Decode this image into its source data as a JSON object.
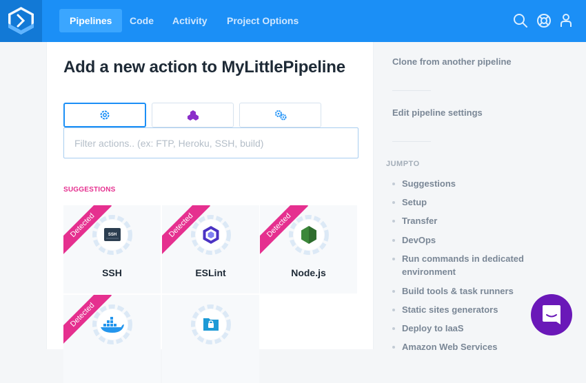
{
  "nav": {
    "items": [
      {
        "label": "Pipelines",
        "active": true
      },
      {
        "label": "Code",
        "active": false
      },
      {
        "label": "Activity",
        "active": false
      },
      {
        "label": "Project Options",
        "active": false
      }
    ],
    "icons": [
      "search-icon",
      "help-lifebuoy-icon",
      "user-icon"
    ]
  },
  "main": {
    "title": "Add a new action to MyLittlePipeline",
    "tabs": [
      "actions-gear-icon",
      "cubes-icon",
      "gears-icon"
    ],
    "filter_placeholder": "Filter actions.. (ex: FTP, Heroku, SSH, build)",
    "suggestions_heading": "SUGGESTIONS",
    "badge_text": "Detected",
    "tiles": [
      {
        "label": "SSH",
        "detected": true,
        "icon": "ssh-terminal-icon"
      },
      {
        "label": "ESLint",
        "detected": true,
        "icon": "eslint-icon"
      },
      {
        "label": "Node.js",
        "detected": true,
        "icon": "nodejs-icon"
      },
      {
        "label": "",
        "detected": true,
        "icon": "docker-icon"
      },
      {
        "label": "",
        "detected": false,
        "icon": "sftp-folder-icon"
      }
    ]
  },
  "sidebar": {
    "links": [
      "Clone from another pipeline",
      "Edit pipeline settings"
    ],
    "jumpto_heading": "JUMPTO",
    "jump_items": [
      "Suggestions",
      "Setup",
      "Transfer",
      "DevOps",
      "Run commands in dedicated environment",
      "Build tools & task runners",
      "Static sites generators",
      "Deploy to IaaS",
      "Amazon Web Services"
    ]
  },
  "colors": {
    "brand": "#1b8ff6",
    "accent": "#e5308f",
    "chat": "#6a18b8"
  }
}
